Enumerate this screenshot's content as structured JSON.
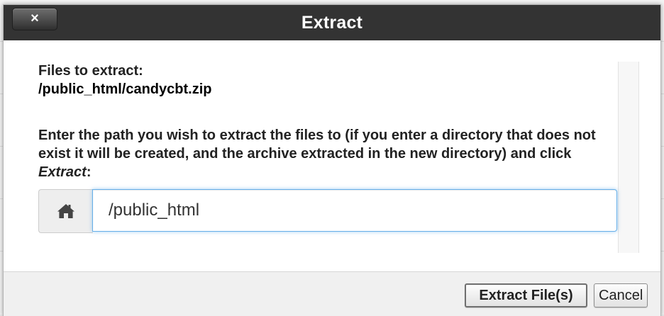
{
  "dialog": {
    "title": "Extract",
    "close_label": "×"
  },
  "content": {
    "files_label": "Files to extract:",
    "file_path": "/public_html/candycbt.zip",
    "instructions_before": "Enter the path you wish to extract the files to (if you enter a directory that does not exist it will be created, and the archive extracted in the new directory) and click ",
    "instructions_action": "Extract",
    "instructions_after": ":"
  },
  "path_input": {
    "icon": "home-icon",
    "value": "/public_html"
  },
  "footer": {
    "extract_label": "Extract File(s)",
    "cancel_label": "Cancel"
  },
  "colors": {
    "titlebar": "#333333",
    "input_focus": "#66afe9"
  }
}
